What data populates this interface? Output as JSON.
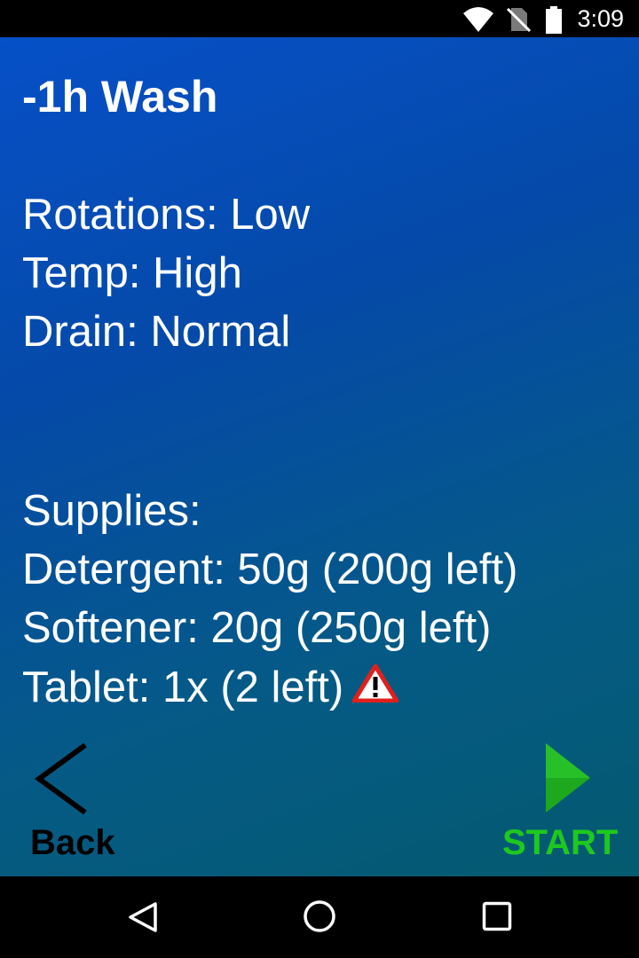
{
  "status_bar": {
    "time": "3:09",
    "icons": [
      "wifi-icon",
      "no-sim-icon",
      "battery-icon"
    ]
  },
  "program": {
    "title": "-1h Wash",
    "settings": [
      "Rotations: Low",
      "Temp: High",
      "Drain: Normal"
    ],
    "supplies_header": "Supplies:",
    "supplies": [
      "Detergent: 50g (200g left)",
      "Softener: 20g (250g left)",
      "Tablet: 1x (2 left)"
    ],
    "tablet_warning_icon": "warning-triangle-icon"
  },
  "actions": {
    "back_label": "Back",
    "start_label": "START"
  },
  "colors": {
    "start": "#1ec81e",
    "warning": "#e0201c"
  },
  "nav_bar": {
    "icons": [
      "back-triangle-icon",
      "home-circle-icon",
      "recents-square-icon"
    ]
  }
}
